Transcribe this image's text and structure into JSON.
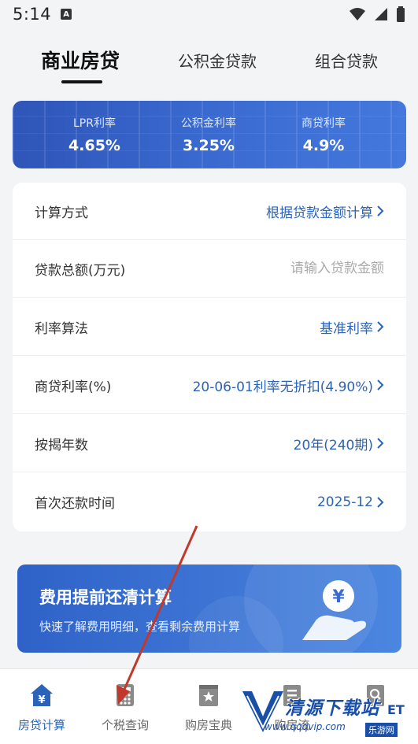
{
  "status": {
    "time": "5:14",
    "notif_letter": "A"
  },
  "tabs": [
    {
      "label": "商业房贷",
      "active": true
    },
    {
      "label": "公积金贷款",
      "active": false
    },
    {
      "label": "组合贷款",
      "active": false
    }
  ],
  "rates": [
    {
      "label": "LPR利率",
      "value": "4.65%"
    },
    {
      "label": "公积金利率",
      "value": "3.25%"
    },
    {
      "label": "商贷利率",
      "value": "4.9%"
    }
  ],
  "form": {
    "calc_method": {
      "label": "计算方式",
      "value": "根据贷款金额计算"
    },
    "loan_total": {
      "label": "贷款总额(万元)",
      "placeholder": "请输入贷款金额",
      "value": ""
    },
    "rate_method": {
      "label": "利率算法",
      "value": "基准利率"
    },
    "commercial_rate": {
      "label": "商贷利率(%)",
      "value": "20-06-01利率无折扣(4.90%)"
    },
    "years": {
      "label": "按揭年数",
      "value": "20年(240期)"
    },
    "first_payment": {
      "label": "首次还款时间",
      "value": "2025-12"
    }
  },
  "promo": {
    "title": "费用提前还清计算",
    "subtitle": "快速了解费用明细，查看剩余费用计算",
    "icon": "yen-hand-icon"
  },
  "bottom_nav": [
    {
      "label": "房贷计算",
      "icon": "house-yen-icon",
      "active": true
    },
    {
      "label": "个税查询",
      "icon": "calculator-icon",
      "active": false
    },
    {
      "label": "购房宝典",
      "icon": "book-star-icon",
      "active": false
    },
    {
      "label": "购房流",
      "icon": "list-icon",
      "active": false
    },
    {
      "label": "",
      "icon": "search-doc-icon",
      "active": false
    }
  ],
  "watermark": {
    "text": "清源下载站",
    "url": "www.qqqvip.com",
    "net": "ET",
    "le": "乐游网"
  },
  "colors": {
    "accent": "#2a63b8",
    "banner": "#3a6ad0",
    "annotation_arrow": "#c0392b"
  }
}
